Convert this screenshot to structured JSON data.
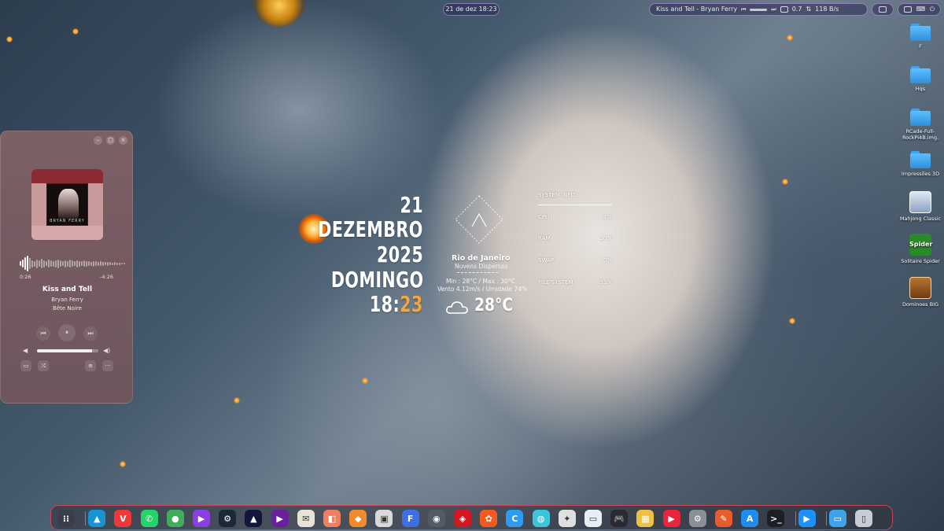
{
  "top_panel": {
    "clock": "21 de dez 18:23",
    "media_title": "Kiss and Tell - Bryan Ferry",
    "memory": "0.7",
    "network": "118 B/s"
  },
  "player": {
    "elapsed": "0:26",
    "remaining": "-4:26",
    "title": "Kiss and Tell",
    "artist": "Bryan Ferry",
    "album": "Bête Noire",
    "cover_text": "BRYAN FERRY",
    "progress": 0.09,
    "volume": 0.9,
    "controls": {
      "min": "–",
      "max": "□",
      "close": "×",
      "prev": "⏮",
      "pause": "⏸",
      "next": "⏭",
      "vol_low": "◀",
      "vol_high": "◀)",
      "sidebar": "▭",
      "shuffle": "⤮",
      "queue": "≡",
      "more": "···"
    }
  },
  "date_widget": {
    "day": "21",
    "month": "DEZEMBRO",
    "year": "2025",
    "weekday": "DOMINGO",
    "hour": "18:",
    "minutes": "23"
  },
  "weather": {
    "city": "Rio de Janeiro",
    "description": "Nuvens Dispersas",
    "min_max": "Min : 28°C / Max : 30°C",
    "wind_humidity": "Vento 4.12m/s / Umidade 74%",
    "temperature": "28°C",
    "icon": "cloud-icon"
  },
  "system_info": {
    "title": "SYSTEM INFO :",
    "rows": [
      {
        "label": "CPU",
        "value": "3%"
      },
      {
        "label": "RAM",
        "value": "20%"
      },
      {
        "label": "SWAP",
        "value": "0%"
      },
      {
        "label": "FILE SYSTEM",
        "value": "33%"
      }
    ]
  },
  "desktop_icons": [
    {
      "label": "F",
      "icon": "folder-icon"
    },
    {
      "label": "Hqs",
      "icon": "folder-icon"
    },
    {
      "label": "RCade-Full-RockPi4B.img.",
      "icon": "folder-icon"
    },
    {
      "label": "Impressões 3D",
      "icon": "folder-icon"
    },
    {
      "label": "Mahjong Classic",
      "icon": "mahjong-icon"
    },
    {
      "label": "Solitaire Spider",
      "icon": "spider-solitaire-icon",
      "badge": "Spider"
    },
    {
      "label": "Dominoes BIG",
      "icon": "dominoes-icon"
    }
  ],
  "dock": {
    "items": [
      {
        "name": "app-grid",
        "glyph": "⁝⁝",
        "color": "#3b3d48"
      },
      {
        "name": "arch-linux",
        "glyph": "▲",
        "color": "#1793d1"
      },
      {
        "name": "vivaldi",
        "glyph": "V",
        "color": "#ef3939"
      },
      {
        "name": "whatsapp",
        "glyph": "✆",
        "color": "#25d366"
      },
      {
        "name": "app-green",
        "glyph": "●",
        "color": "#3fae5a"
      },
      {
        "name": "media-player",
        "glyph": "▶",
        "color": "#8a3fe0"
      },
      {
        "name": "steam",
        "glyph": "⚙",
        "color": "#1b2838"
      },
      {
        "name": "affinity",
        "glyph": "▲",
        "color": "#12163a"
      },
      {
        "name": "video-player",
        "glyph": "▶",
        "color": "#6a1f9c"
      },
      {
        "name": "photo-app",
        "glyph": "✉",
        "color": "#e9e3d6"
      },
      {
        "name": "pictures",
        "glyph": "◧",
        "color": "#f07f5f"
      },
      {
        "name": "office",
        "glyph": "◆",
        "color": "#f08a2a"
      },
      {
        "name": "archive",
        "glyph": "▣",
        "color": "#d9d9d9"
      },
      {
        "name": "fluent",
        "glyph": "F",
        "color": "#3d6fe0"
      },
      {
        "name": "disk",
        "glyph": "◉",
        "color": "#555b66"
      },
      {
        "name": "tv-app",
        "glyph": "◈",
        "color": "#d4161f"
      },
      {
        "name": "camera-app",
        "glyph": "✿",
        "color": "#f25a1f"
      },
      {
        "name": "c-app",
        "glyph": "C",
        "color": "#2d9cf0"
      },
      {
        "name": "maps-app",
        "glyph": "◍",
        "color": "#3bc6d8"
      },
      {
        "name": "puzzle",
        "glyph": "✦",
        "color": "#e0e0e0"
      },
      {
        "name": "notes",
        "glyph": "▭",
        "color": "#e8eef4"
      },
      {
        "name": "gamepad",
        "glyph": "🎮",
        "color": "#2a2a30"
      },
      {
        "name": "calc",
        "glyph": "▦",
        "color": "#f0c040"
      },
      {
        "name": "video-download",
        "glyph": "▶",
        "color": "#e8253a"
      },
      {
        "name": "settings",
        "glyph": "⚙",
        "color": "#8c8f96"
      },
      {
        "name": "editor",
        "glyph": "✎",
        "color": "#e85c2a"
      },
      {
        "name": "app-store",
        "glyph": "A",
        "color": "#1c8ef2"
      },
      {
        "name": "terminal",
        "glyph": ">_",
        "color": "#1e1f24"
      },
      {
        "name": "downloader",
        "glyph": "▶",
        "color": "#1e90ff"
      },
      {
        "name": "files",
        "glyph": "▭",
        "color": "#3fa2ea"
      },
      {
        "name": "trash",
        "glyph": "▯",
        "color": "#c9ccd2"
      }
    ]
  }
}
